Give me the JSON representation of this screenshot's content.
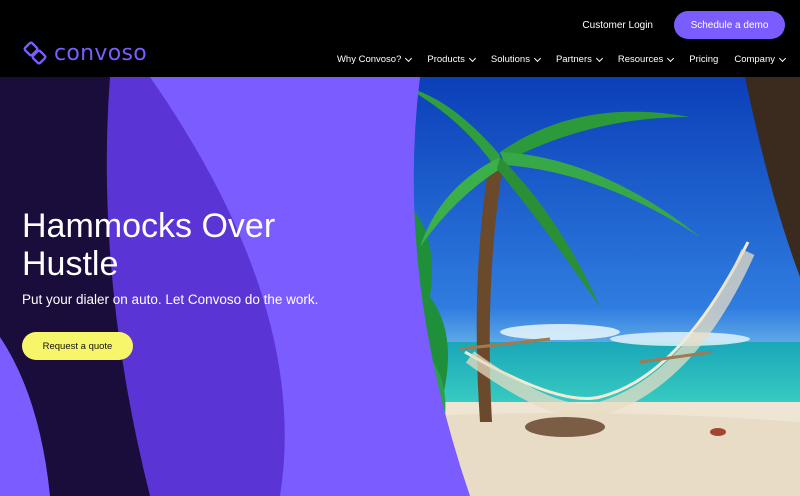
{
  "brand": {
    "name": "convoso",
    "logo_color": "#7b5cff"
  },
  "top_links": {
    "login": "Customer Login",
    "demo": "Schedule a demo"
  },
  "nav": {
    "items": [
      {
        "label": "Why Convoso?",
        "has_dropdown": true
      },
      {
        "label": "Products",
        "has_dropdown": true
      },
      {
        "label": "Solutions",
        "has_dropdown": true
      },
      {
        "label": "Partners",
        "has_dropdown": true
      },
      {
        "label": "Resources",
        "has_dropdown": true
      },
      {
        "label": "Pricing",
        "has_dropdown": false
      },
      {
        "label": "Company",
        "has_dropdown": true
      }
    ]
  },
  "hero": {
    "headline_line1": "Hammocks Over",
    "headline_line2": "Hustle",
    "subheadline": "Put your dialer on auto. Let Convoso do the work.",
    "cta": "Request a quote",
    "image": "beach-hammock-palm-photo"
  },
  "colors": {
    "accent": "#7b5cff",
    "deep_purple": "#5b34d6",
    "dark": "#1b0d3b",
    "cta": "#f7f66b"
  }
}
